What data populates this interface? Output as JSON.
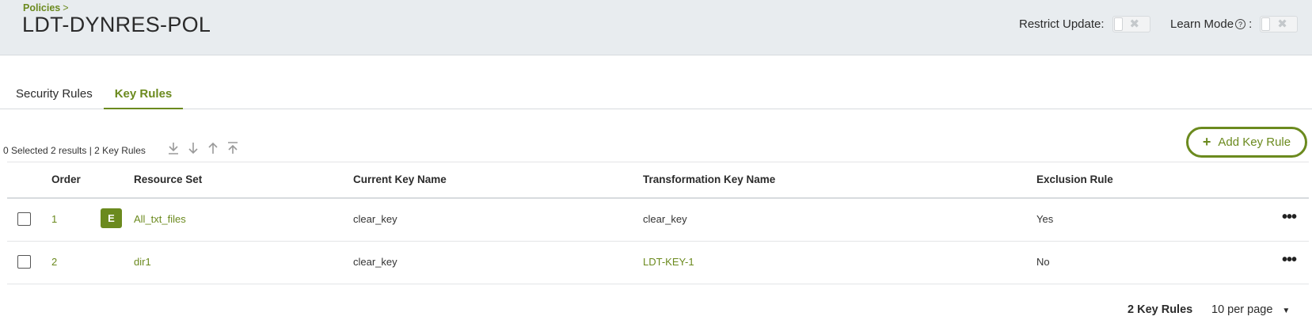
{
  "breadcrumb": {
    "label": "Policies",
    "separator": ">"
  },
  "page_title": "LDT-DYNRES-POL",
  "header_controls": {
    "restrict_update_label": "Restrict Update:",
    "learn_mode_label": "Learn Mode",
    "learn_mode_colon": ":",
    "help_glyph": "?",
    "toggle_off_glyph": "✖"
  },
  "tabs": [
    {
      "label": "Security Rules",
      "active": false
    },
    {
      "label": "Key Rules",
      "active": true
    }
  ],
  "toolbar": {
    "selection_summary": "0 Selected 2 results | 2 Key Rules",
    "icons": [
      "move-to-bottom-icon",
      "move-down-icon",
      "move-up-icon",
      "move-to-top-icon"
    ]
  },
  "add_button": {
    "plus": "+",
    "label": "Add Key Rule"
  },
  "table": {
    "headers": {
      "order": "Order",
      "resource_set": "Resource Set",
      "current_key": "Current Key Name",
      "transformation_key": "Transformation Key Name",
      "exclusion_rule": "Exclusion Rule"
    },
    "rows": [
      {
        "order": "1",
        "badge": "E",
        "resource_set": "All_txt_files",
        "current_key": "clear_key",
        "transformation_key": "clear_key",
        "exclusion_rule": "Yes",
        "more": "•••"
      },
      {
        "order": "2",
        "badge": "",
        "resource_set": "dir1",
        "current_key": "clear_key",
        "transformation_key": "LDT-KEY-1",
        "exclusion_rule": "No",
        "more": "•••"
      }
    ]
  },
  "pagination": {
    "total": "2 Key Rules",
    "per_page": "10 per page",
    "caret": "▼"
  },
  "colors": {
    "accent": "#6b8a1e",
    "header_bg": "#e8ecef"
  }
}
